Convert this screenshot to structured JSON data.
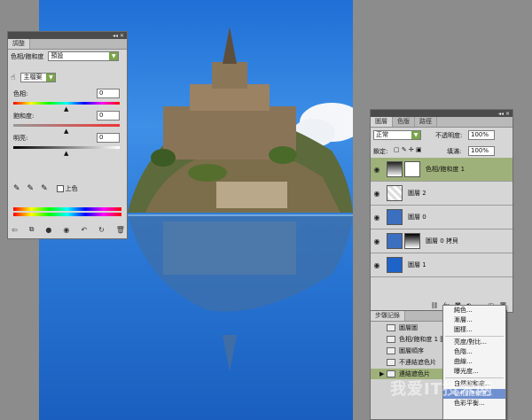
{
  "adjust_panel": {
    "title": "調整",
    "mode_label": "色相/飽和度",
    "preset_value": "預設",
    "channel_value": "主檔案",
    "hue_label": "色相:",
    "hue_value": "0",
    "saturation_label": "飽和度:",
    "saturation_value": "0",
    "lightness_label": "明亮:",
    "lightness_value": "0",
    "colorize_label": "上色"
  },
  "layers_panel": {
    "tabs": [
      "圖層",
      "色版",
      "路徑"
    ],
    "blend_mode": "正常",
    "opacity_label": "不透明度:",
    "opacity_value": "100%",
    "lock_label": "鎖定:",
    "fill_label": "填滿:",
    "fill_value": "100%",
    "layers": [
      {
        "name": "色相/飽和度 1"
      },
      {
        "name": "圖層 2"
      },
      {
        "name": "圖層 0"
      },
      {
        "name": "圖層 0 拷貝"
      },
      {
        "name": "圖層 1"
      }
    ]
  },
  "history_panel": {
    "tab": "步驟記錄",
    "items": [
      "圖層圖",
      "色相/飽和度 1 圖",
      "圖層順序",
      "不連結遮色片",
      "連結遮色片"
    ]
  },
  "adjust_menu": {
    "items": [
      "純色...",
      "漸層...",
      "圖樣...",
      "亮度/對比...",
      "色階...",
      "曲線...",
      "曝光度...",
      "自然飽和度...",
      "色相/飽和度...",
      "色彩平衡..."
    ],
    "highlighted_index": 8
  },
  "watermark": "我爱IT技术网",
  "colors": {
    "selection": "#9fb17a",
    "accent_green": "#7aa54a",
    "menu_highlight": "#6f8fd0"
  }
}
